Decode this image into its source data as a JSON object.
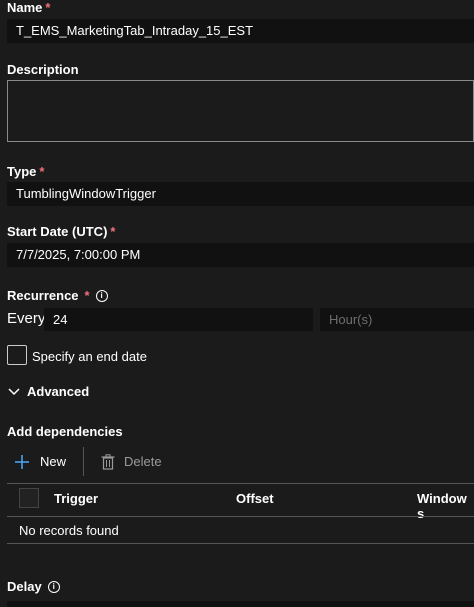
{
  "name": {
    "label": "Name",
    "required": "*",
    "value": "T_EMS_MarketingTab_Intraday_15_EST"
  },
  "description": {
    "label": "Description",
    "value": ""
  },
  "type": {
    "label": "Type",
    "required": "*",
    "value": "TumblingWindowTrigger"
  },
  "start_date": {
    "label": "Start Date (UTC)",
    "required": "*",
    "value": "7/7/2025, 7:00:00 PM"
  },
  "recurrence": {
    "label": "Recurrence",
    "required": "*",
    "info": "i",
    "every_label": "Every",
    "interval": "24",
    "unit_placeholder": "Hour(s)"
  },
  "end_date": {
    "label": "Specify an end date",
    "checked": false
  },
  "advanced": {
    "label": "Advanced"
  },
  "dependencies": {
    "title": "Add dependencies",
    "new_label": "New",
    "delete_label": "Delete",
    "columns": [
      "Trigger",
      "Offset",
      "Window s"
    ],
    "empty": "No records found"
  },
  "delay": {
    "label": "Delay",
    "info": "i"
  },
  "colors": {
    "background": "#1b1b1b",
    "field": "#111111",
    "accent": "#4aa1f0",
    "required": "#f1707b",
    "border": "#8a8a8a"
  }
}
